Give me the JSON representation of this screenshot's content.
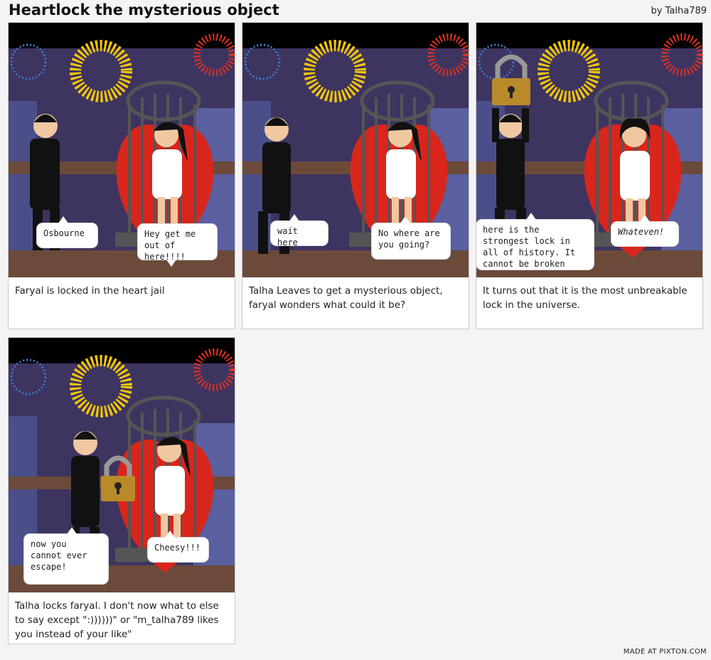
{
  "header": {
    "title": "Heartlock the mysterious object",
    "author": "by Talha789"
  },
  "footer": {
    "credit": "MADE AT PIXTON.COM"
  },
  "panels": [
    {
      "bubbles": [
        "Osbourne",
        "Hey get me out of here!!!!"
      ],
      "caption": "Faryal is locked in the heart jail"
    },
    {
      "bubbles": [
        "wait here",
        "No where are you going?"
      ],
      "caption": "Talha Leaves to get a mysterious object, faryal wonders what could it be?"
    },
    {
      "bubbles": [
        "here is the strongest lock in all of history. It cannot be broken",
        "Whateven!"
      ],
      "caption": "It turns out that it is the most unbreakable lock in the universe."
    },
    {
      "bubbles": [
        "now you cannot ever escape!",
        "Cheesy!!!"
      ],
      "caption": "Talha locks faryal. I don't now what to else to say except \":))))))\" or \"m_talha789 likes you instead of your like\""
    }
  ],
  "colors": {
    "night_sky": "#3e3460",
    "heart": "#d8261c",
    "firework_blue": "#3a7fd0",
    "firework_yellow": "#f5c800",
    "firework_red": "#e03020",
    "cage": "#555555",
    "floor": "#6b4a3a",
    "padlock": "#b98a2a"
  }
}
